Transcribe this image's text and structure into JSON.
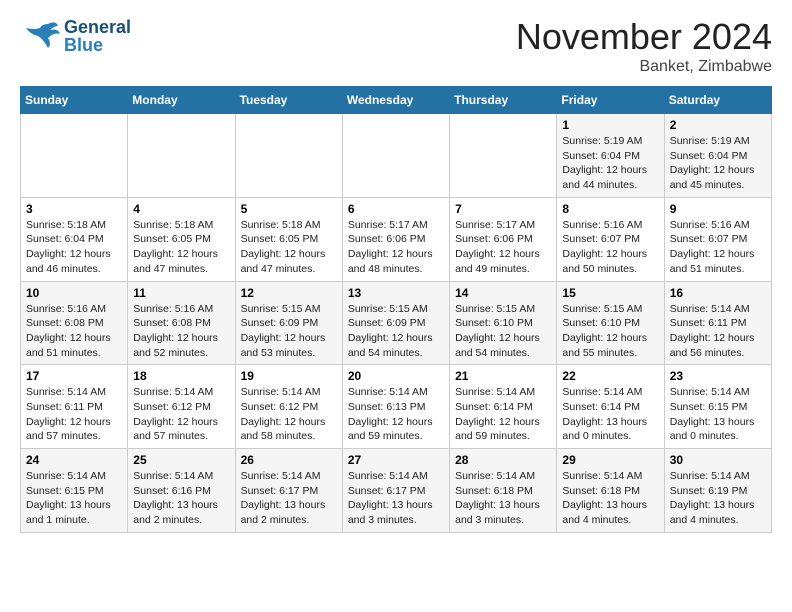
{
  "header": {
    "logo_general": "General",
    "logo_blue": "Blue",
    "title": "November 2024",
    "subtitle": "Banket, Zimbabwe"
  },
  "days_of_week": [
    "Sunday",
    "Monday",
    "Tuesday",
    "Wednesday",
    "Thursday",
    "Friday",
    "Saturday"
  ],
  "weeks": [
    [
      {
        "day": "",
        "info": ""
      },
      {
        "day": "",
        "info": ""
      },
      {
        "day": "",
        "info": ""
      },
      {
        "day": "",
        "info": ""
      },
      {
        "day": "",
        "info": ""
      },
      {
        "day": "1",
        "info": "Sunrise: 5:19 AM\nSunset: 6:04 PM\nDaylight: 12 hours\nand 44 minutes."
      },
      {
        "day": "2",
        "info": "Sunrise: 5:19 AM\nSunset: 6:04 PM\nDaylight: 12 hours\nand 45 minutes."
      }
    ],
    [
      {
        "day": "3",
        "info": "Sunrise: 5:18 AM\nSunset: 6:04 PM\nDaylight: 12 hours\nand 46 minutes."
      },
      {
        "day": "4",
        "info": "Sunrise: 5:18 AM\nSunset: 6:05 PM\nDaylight: 12 hours\nand 47 minutes."
      },
      {
        "day": "5",
        "info": "Sunrise: 5:18 AM\nSunset: 6:05 PM\nDaylight: 12 hours\nand 47 minutes."
      },
      {
        "day": "6",
        "info": "Sunrise: 5:17 AM\nSunset: 6:06 PM\nDaylight: 12 hours\nand 48 minutes."
      },
      {
        "day": "7",
        "info": "Sunrise: 5:17 AM\nSunset: 6:06 PM\nDaylight: 12 hours\nand 49 minutes."
      },
      {
        "day": "8",
        "info": "Sunrise: 5:16 AM\nSunset: 6:07 PM\nDaylight: 12 hours\nand 50 minutes."
      },
      {
        "day": "9",
        "info": "Sunrise: 5:16 AM\nSunset: 6:07 PM\nDaylight: 12 hours\nand 51 minutes."
      }
    ],
    [
      {
        "day": "10",
        "info": "Sunrise: 5:16 AM\nSunset: 6:08 PM\nDaylight: 12 hours\nand 51 minutes."
      },
      {
        "day": "11",
        "info": "Sunrise: 5:16 AM\nSunset: 6:08 PM\nDaylight: 12 hours\nand 52 minutes."
      },
      {
        "day": "12",
        "info": "Sunrise: 5:15 AM\nSunset: 6:09 PM\nDaylight: 12 hours\nand 53 minutes."
      },
      {
        "day": "13",
        "info": "Sunrise: 5:15 AM\nSunset: 6:09 PM\nDaylight: 12 hours\nand 54 minutes."
      },
      {
        "day": "14",
        "info": "Sunrise: 5:15 AM\nSunset: 6:10 PM\nDaylight: 12 hours\nand 54 minutes."
      },
      {
        "day": "15",
        "info": "Sunrise: 5:15 AM\nSunset: 6:10 PM\nDaylight: 12 hours\nand 55 minutes."
      },
      {
        "day": "16",
        "info": "Sunrise: 5:14 AM\nSunset: 6:11 PM\nDaylight: 12 hours\nand 56 minutes."
      }
    ],
    [
      {
        "day": "17",
        "info": "Sunrise: 5:14 AM\nSunset: 6:11 PM\nDaylight: 12 hours\nand 57 minutes."
      },
      {
        "day": "18",
        "info": "Sunrise: 5:14 AM\nSunset: 6:12 PM\nDaylight: 12 hours\nand 57 minutes."
      },
      {
        "day": "19",
        "info": "Sunrise: 5:14 AM\nSunset: 6:12 PM\nDaylight: 12 hours\nand 58 minutes."
      },
      {
        "day": "20",
        "info": "Sunrise: 5:14 AM\nSunset: 6:13 PM\nDaylight: 12 hours\nand 59 minutes."
      },
      {
        "day": "21",
        "info": "Sunrise: 5:14 AM\nSunset: 6:14 PM\nDaylight: 12 hours\nand 59 minutes."
      },
      {
        "day": "22",
        "info": "Sunrise: 5:14 AM\nSunset: 6:14 PM\nDaylight: 13 hours\nand 0 minutes."
      },
      {
        "day": "23",
        "info": "Sunrise: 5:14 AM\nSunset: 6:15 PM\nDaylight: 13 hours\nand 0 minutes."
      }
    ],
    [
      {
        "day": "24",
        "info": "Sunrise: 5:14 AM\nSunset: 6:15 PM\nDaylight: 13 hours\nand 1 minute."
      },
      {
        "day": "25",
        "info": "Sunrise: 5:14 AM\nSunset: 6:16 PM\nDaylight: 13 hours\nand 2 minutes."
      },
      {
        "day": "26",
        "info": "Sunrise: 5:14 AM\nSunset: 6:17 PM\nDaylight: 13 hours\nand 2 minutes."
      },
      {
        "day": "27",
        "info": "Sunrise: 5:14 AM\nSunset: 6:17 PM\nDaylight: 13 hours\nand 3 minutes."
      },
      {
        "day": "28",
        "info": "Sunrise: 5:14 AM\nSunset: 6:18 PM\nDaylight: 13 hours\nand 3 minutes."
      },
      {
        "day": "29",
        "info": "Sunrise: 5:14 AM\nSunset: 6:18 PM\nDaylight: 13 hours\nand 4 minutes."
      },
      {
        "day": "30",
        "info": "Sunrise: 5:14 AM\nSunset: 6:19 PM\nDaylight: 13 hours\nand 4 minutes."
      }
    ]
  ]
}
